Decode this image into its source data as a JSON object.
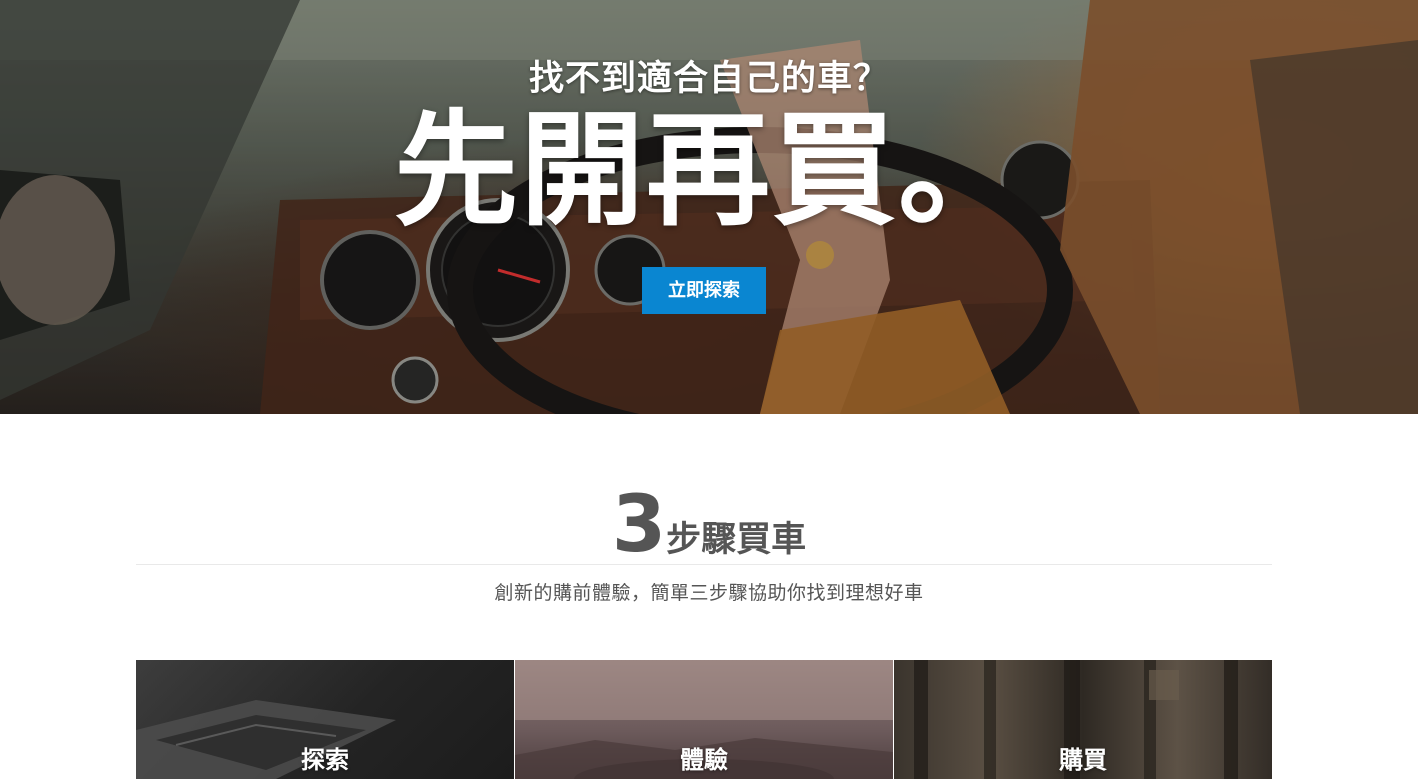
{
  "hero": {
    "subtitle": "找不到適合自己的車？",
    "title": "先開再買。",
    "cta_label": "立即探索"
  },
  "steps": {
    "number": "3",
    "heading_text": "步驟買車",
    "description": "創新的購前體驗，簡單三步驟協助你找到理想好車"
  },
  "cards": [
    {
      "label": "探索"
    },
    {
      "label": "體驗"
    },
    {
      "label": "購買"
    }
  ],
  "colors": {
    "accent": "#0a86d1",
    "heading_text": "#555555",
    "divider": "#e9e9e9"
  },
  "icons": {
    "hero_image": "car-interior-photo",
    "card_1_image": "laptop-photo",
    "card_2_image": "road-photo",
    "card_3_image": "building-photo"
  }
}
